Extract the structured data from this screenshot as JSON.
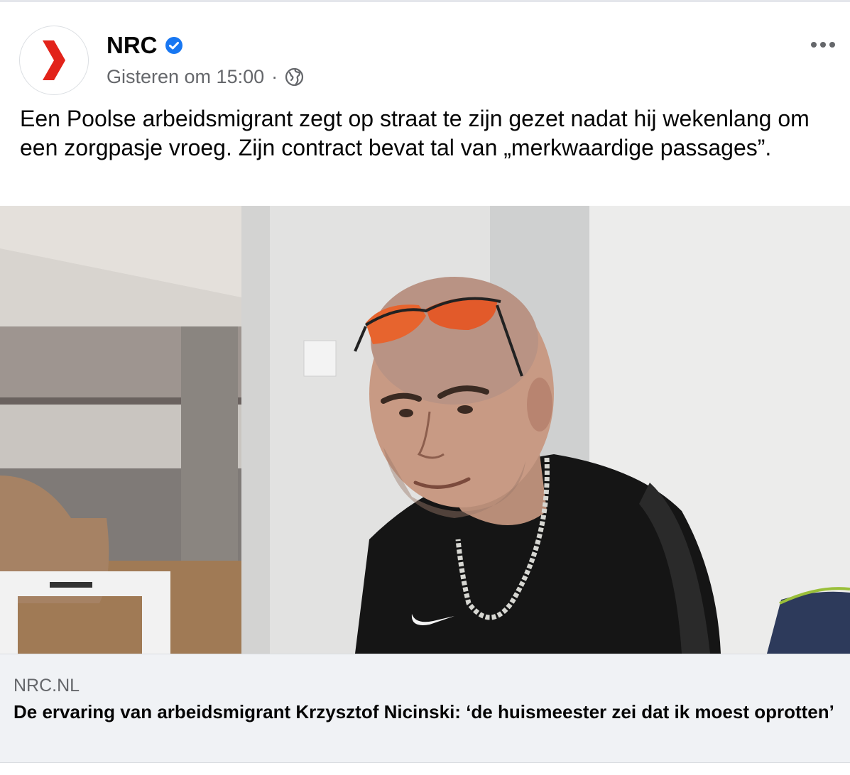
{
  "post": {
    "page_name": "NRC",
    "timestamp": "Gisteren om 15:00",
    "separator": "·",
    "audience_icon": "globe-icon",
    "verified_icon": "verified-badge-icon",
    "more_icon": "more-options-icon",
    "message": "Een Poolse arbeidsmigrant zegt op straat te zijn gezet nadat hij wekenlang om een zorgpasje vroeg. Zijn contract bevat tal van „merkwaardige passages”."
  },
  "link_preview": {
    "domain": "NRC.NL",
    "title": "De ervaring van arbeidsmigrant Krzysztof Nicinski: ‘de huismeester zei dat ik moest oprotten’"
  },
  "colors": {
    "brand_red": "#e2231a",
    "verified_blue": "#1877f2",
    "meta_gray": "#65676b"
  }
}
